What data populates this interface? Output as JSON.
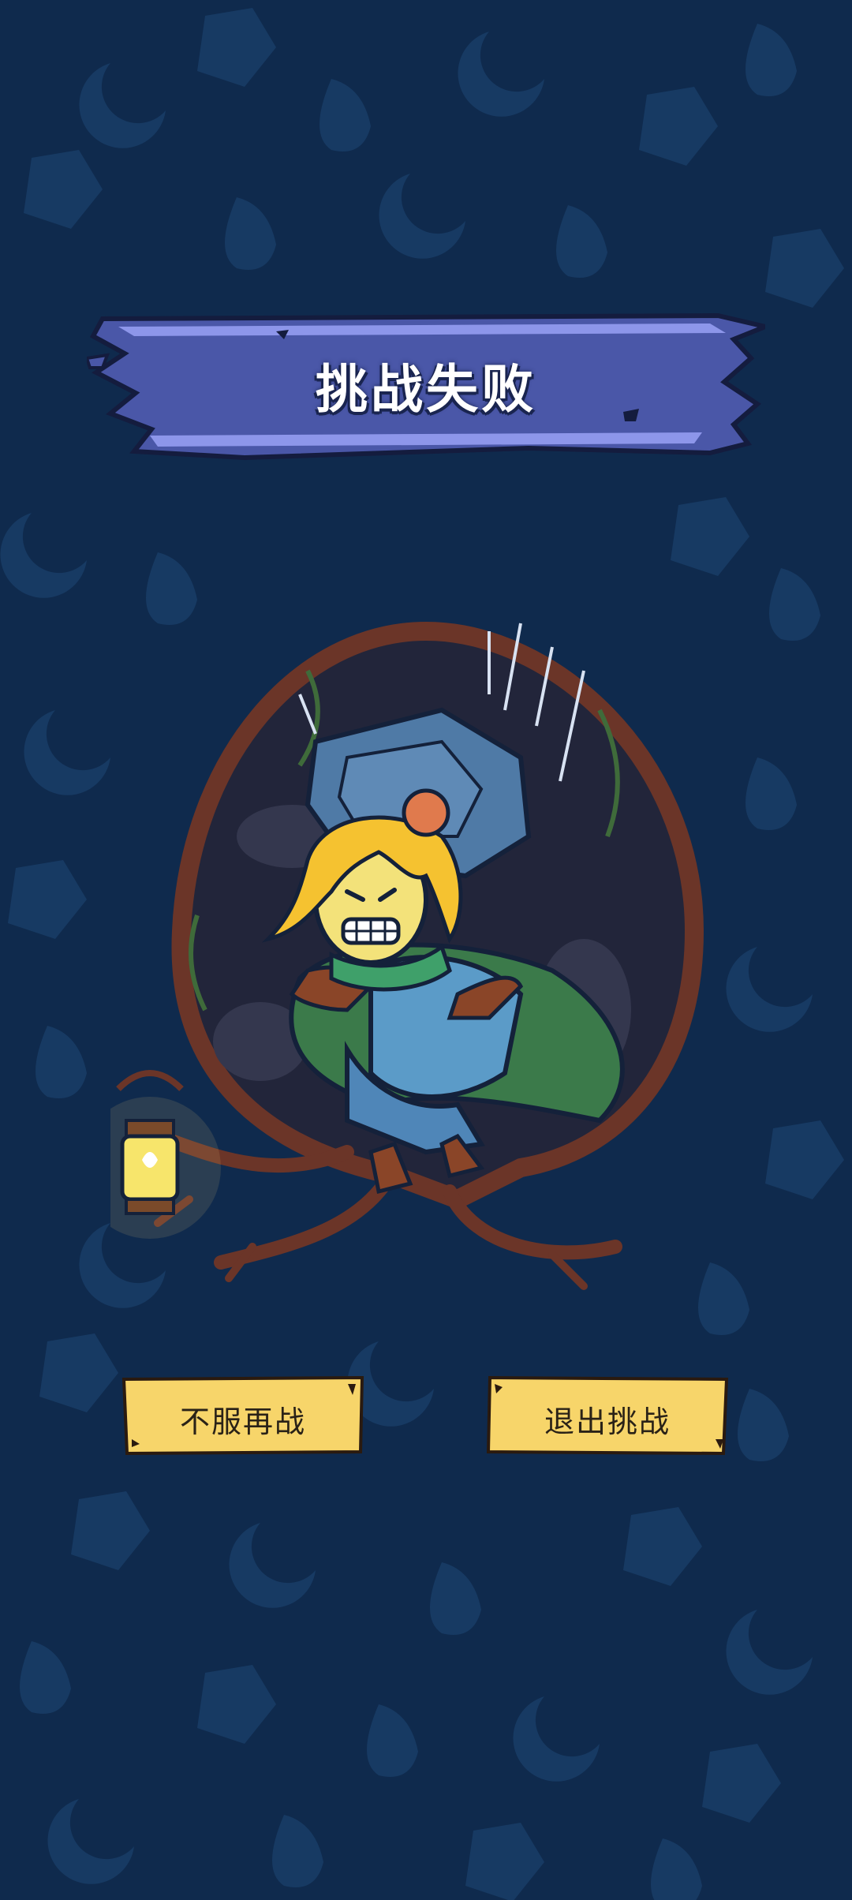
{
  "screen": {
    "title": "挑战失败"
  },
  "actions": {
    "retry_label": "不服再战",
    "exit_label": "退出挑战"
  },
  "illustration": {
    "subject": "defeated-hero-under-boulder"
  },
  "colors": {
    "background": "#0f2a4d",
    "pattern": "#173a63",
    "banner_fill": "#4a57a8",
    "banner_edge": "#8d96ea",
    "button_fill": "#f7d56a",
    "button_text": "#2a2217"
  },
  "icons": {
    "lantern": "lantern-icon",
    "boulder": "boulder-icon"
  }
}
